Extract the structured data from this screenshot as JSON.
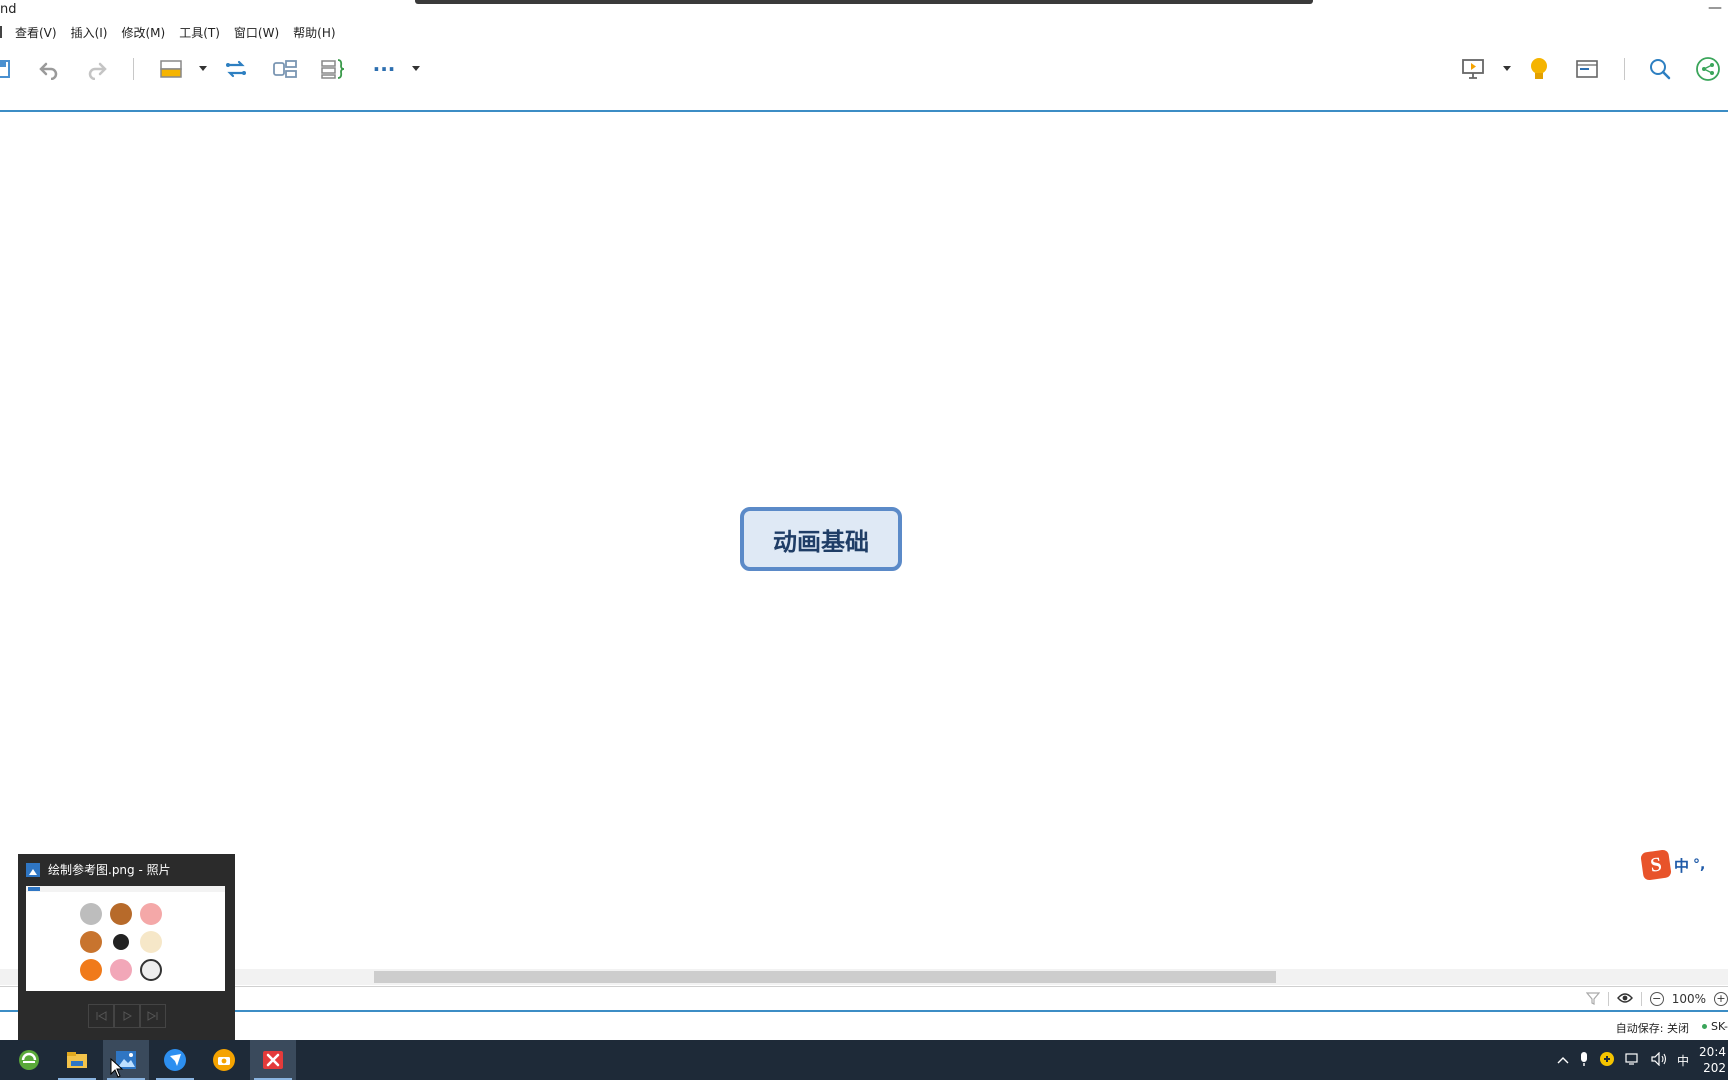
{
  "window": {
    "title_fragment": "nd",
    "minimize_glyph": "—"
  },
  "menu": [
    {
      "label": "查看(V)"
    },
    {
      "label": "插入(I)"
    },
    {
      "label": "修改(M)"
    },
    {
      "label": "工具(T)"
    },
    {
      "label": "窗口(W)"
    },
    {
      "label": "帮助(H)"
    }
  ],
  "toolbar": {
    "left_icons": [
      "save-icon",
      "undo-icon",
      "redo-icon",
      "topic-style-icon",
      "relationship-icon",
      "summary-icon",
      "boundary-icon",
      "more-icon"
    ],
    "right_icons": [
      "presentation-icon",
      "idea-bulb-icon",
      "outline-view-icon",
      "search-icon",
      "share-icon"
    ],
    "more_label": "···"
  },
  "canvas": {
    "central_topic": "动画基础"
  },
  "ime": {
    "logo_letter": "S",
    "mode": "中",
    "punct": "°,"
  },
  "status": {
    "zoom": "100%",
    "zoom_out": "−",
    "zoom_in": "+",
    "autosave": "自动保存: 关闭",
    "account": "SK-"
  },
  "preview": {
    "title": "绘制参考图.png - 照片"
  },
  "taskbar": {
    "apps": [
      "browser-app",
      "file-explorer-app",
      "photos-app",
      "feishu-app",
      "camera-app",
      "xmind-app"
    ],
    "tray": {
      "input_mode": "中",
      "time": "20:4",
      "date": "202"
    }
  },
  "colors": {
    "accent": "#3c8dc5",
    "topic_border": "#5b8ac8",
    "topic_fill": "#dfe9f5",
    "topic_text": "#1f3d66",
    "taskbar": "#1e2a38"
  }
}
